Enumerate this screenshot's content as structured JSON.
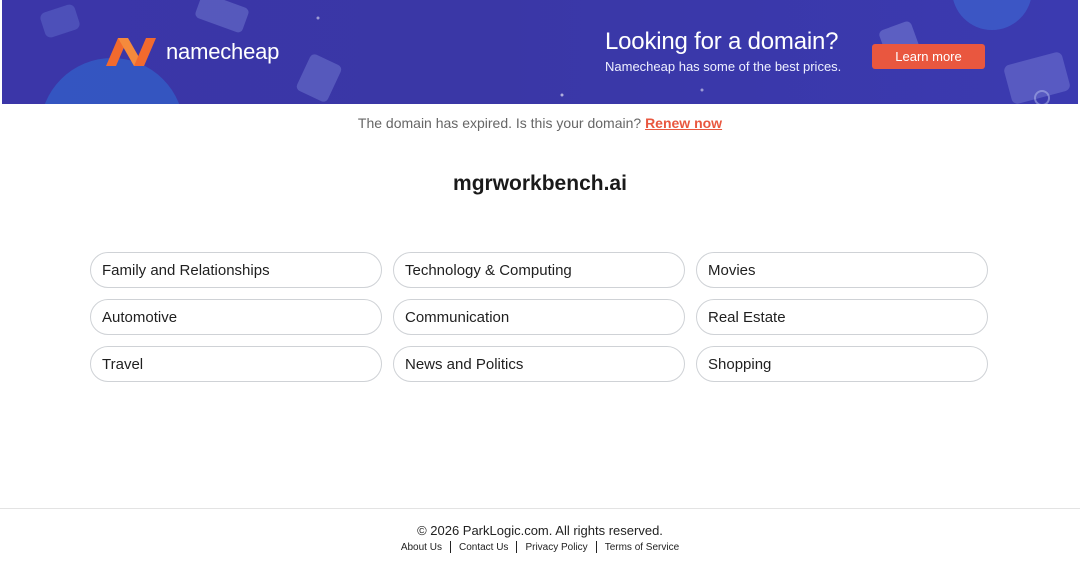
{
  "banner": {
    "logo_text": "namecheap",
    "promo_title": "Looking for a domain?",
    "promo_subtitle": "Namecheap has some of the best prices.",
    "cta_label": "Learn more",
    "colors": {
      "background": "#3b36a8",
      "cta": "#e9573f",
      "logo_orange": "#f26a2e"
    }
  },
  "notice": {
    "text": "The domain has expired. Is this your domain?",
    "link_label": "Renew now"
  },
  "domain": "mgrworkbench.ai",
  "categories": [
    "Family and Relationships",
    "Technology & Computing",
    "Movies",
    "Automotive",
    "Communication",
    "Real Estate",
    "Travel",
    "News and Politics",
    "Shopping"
  ],
  "footer": {
    "copyright": "© 2026 ParkLogic.com. All rights reserved.",
    "links": [
      "About Us",
      "Contact Us",
      "Privacy Policy",
      "Terms of Service"
    ]
  }
}
